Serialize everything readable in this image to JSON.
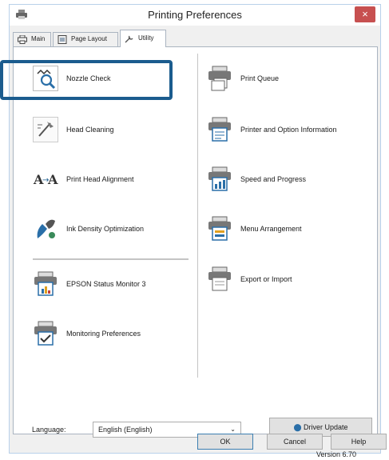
{
  "window": {
    "title": "Printing Preferences",
    "close_glyph": "×"
  },
  "tabs": [
    {
      "label": "Main",
      "icon": "printer-icon"
    },
    {
      "label": "Page Layout",
      "icon": "page-layout-icon"
    },
    {
      "label": "Utility",
      "icon": "wrench-icon"
    }
  ],
  "utility_left": [
    {
      "label": "Nozzle Check",
      "icon": "nozzle-check-icon"
    },
    {
      "label": "Head Cleaning",
      "icon": "head-cleaning-icon"
    },
    {
      "label": "Print Head Alignment",
      "icon": "print-head-alignment-icon"
    },
    {
      "label": "Ink Density Optimization",
      "icon": "ink-density-icon"
    },
    {
      "label": "EPSON Status Monitor 3",
      "icon": "status-monitor-icon"
    },
    {
      "label": "Monitoring Preferences",
      "icon": "monitoring-preferences-icon"
    }
  ],
  "utility_right": [
    {
      "label": "Print Queue",
      "icon": "print-queue-icon"
    },
    {
      "label": "Printer and Option Information",
      "icon": "printer-info-icon"
    },
    {
      "label": "Speed and Progress",
      "icon": "speed-progress-icon"
    },
    {
      "label": "Menu Arrangement",
      "icon": "menu-arrangement-icon"
    },
    {
      "label": "Export or Import",
      "icon": "export-import-icon"
    }
  ],
  "language": {
    "label": "Language:",
    "selected": "English (English)"
  },
  "driver_update": {
    "label": "Driver Update",
    "icon": "globe-update-icon"
  },
  "version": "Version 6.70",
  "buttons": {
    "ok": "OK",
    "cancel": "Cancel",
    "help": "Help"
  },
  "colors": {
    "highlight": "#1b5c8e",
    "close": "#c75050",
    "window_border": "#b9d1ea"
  }
}
